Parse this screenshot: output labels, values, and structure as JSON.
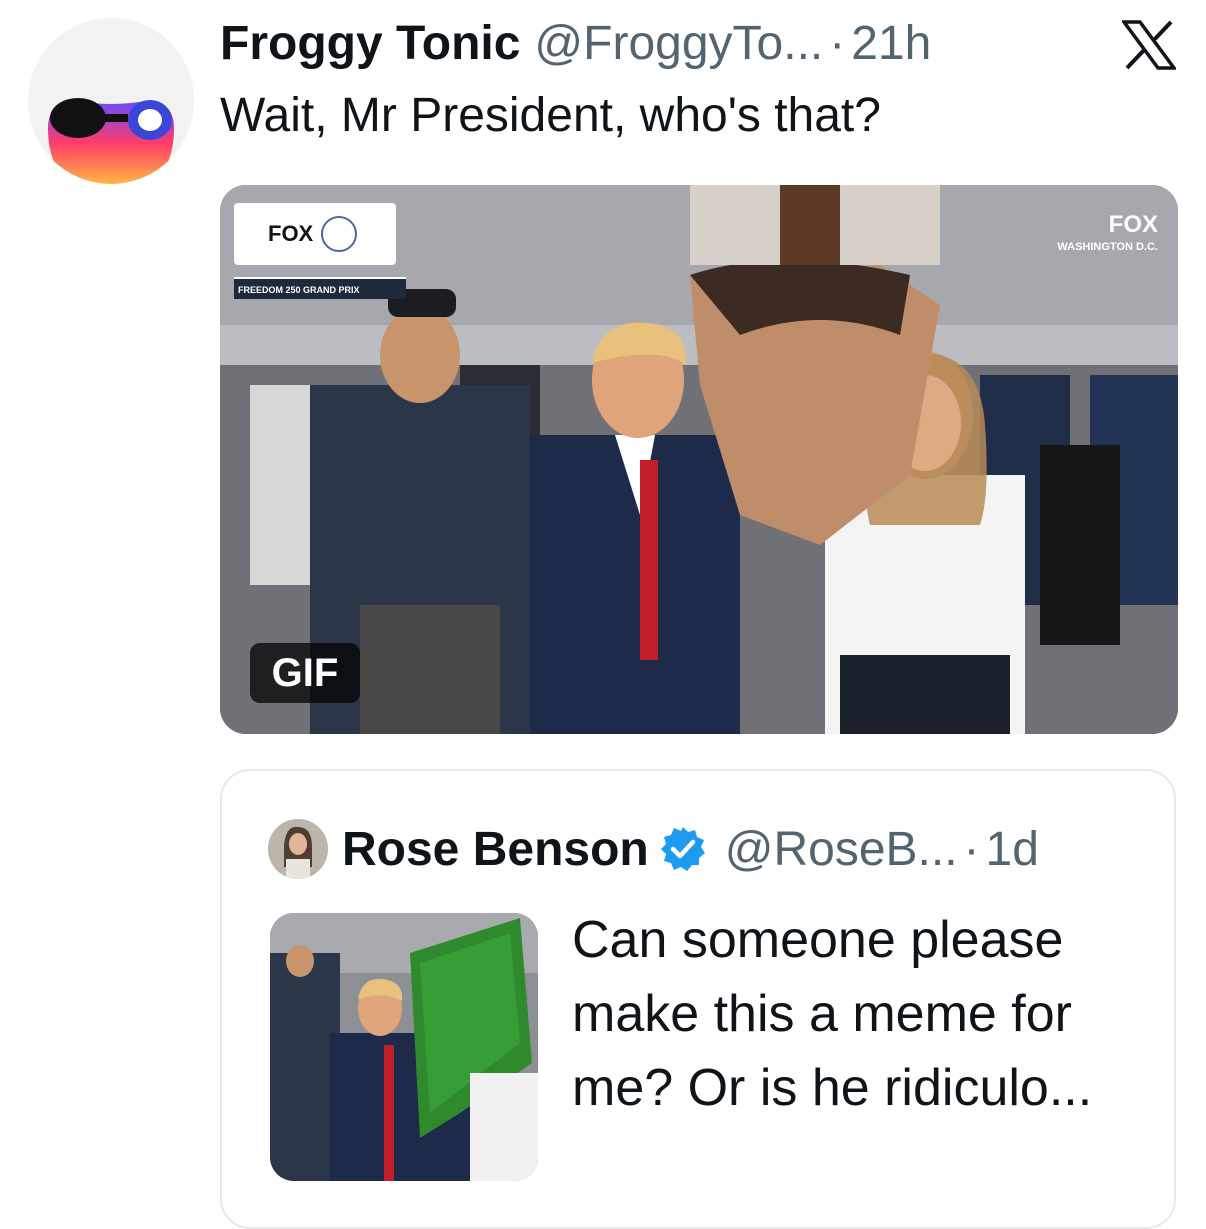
{
  "tweet": {
    "display_name": "Froggy Tonic",
    "handle": "@FroggyTo...",
    "separator": "·",
    "time": "21h",
    "text": "Wait, Mr President, who's that?",
    "avatar_icon": "frog-sunglasses-avatar",
    "platform_icon": "x-logo-icon",
    "media": {
      "type": "gif",
      "badge": "GIF",
      "overlay_left_logo": "FOX",
      "overlay_left_caption": "FREEDOM 250 GRAND PRIX",
      "overlay_right_logo": "FOX",
      "overlay_right_location": "WASHINGTON D.C."
    }
  },
  "quoted_tweet": {
    "display_name": "Rose Benson",
    "handle": "@RoseB...",
    "separator": "·",
    "time": "1d",
    "verified": true,
    "verified_color": "#1d9bf0",
    "text": "Can someone please make this a meme for me? Or is he ridiculo..."
  },
  "colors": {
    "text_primary": "#0f1419",
    "text_secondary": "#536471",
    "border": "#e6e9eb"
  }
}
